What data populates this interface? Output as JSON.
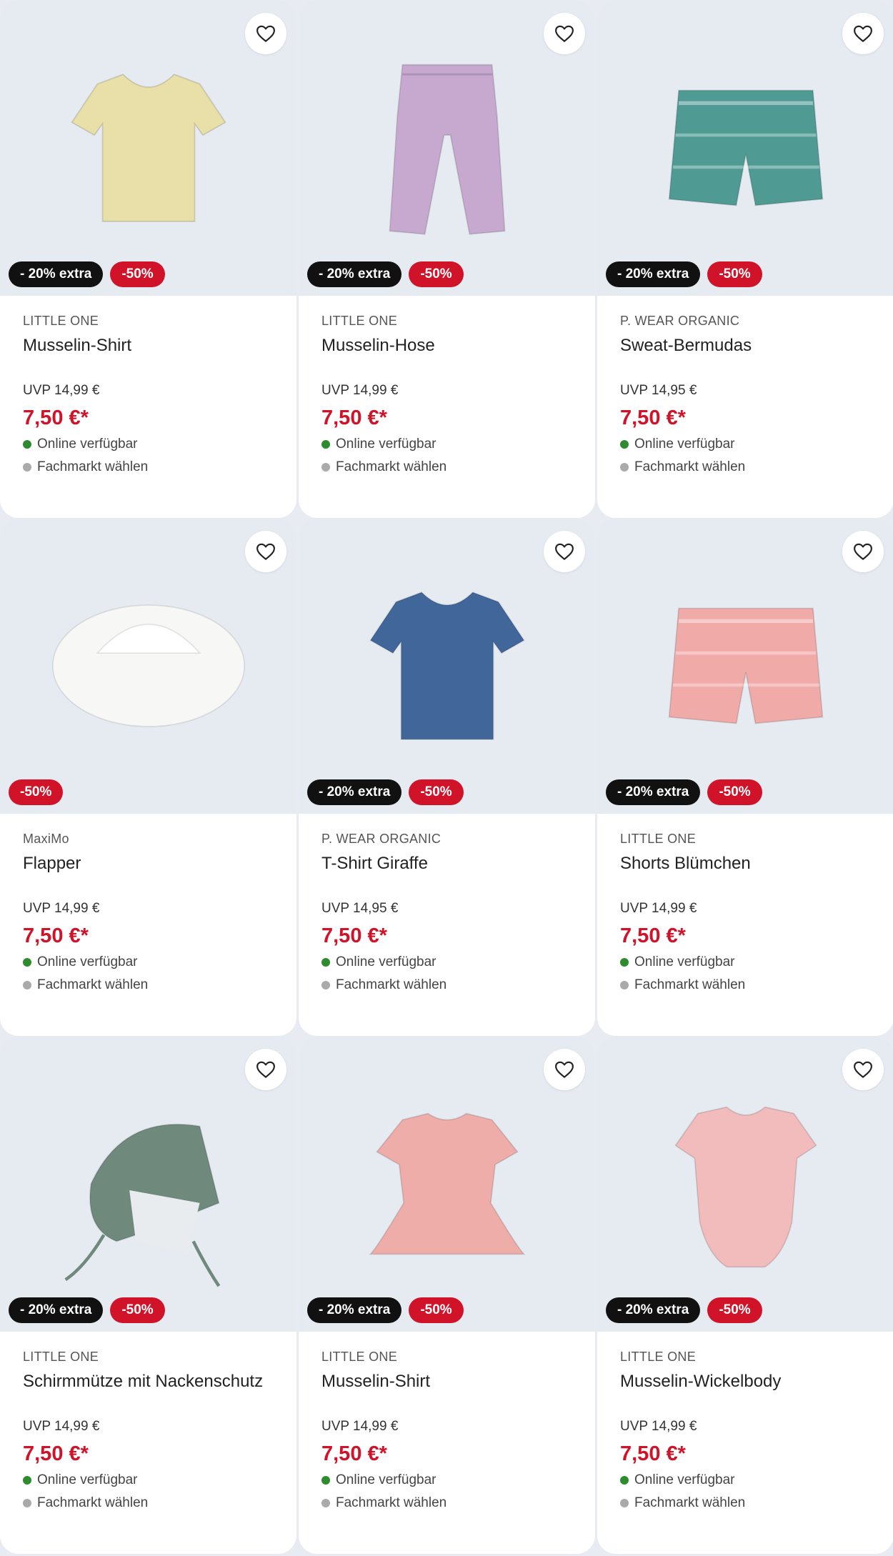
{
  "products": [
    {
      "brand": "LITTLE ONE",
      "title": "Musselin-Shirt",
      "uvp": "UVP 14,99 €",
      "price": "7,50 €*",
      "badge_extra": "- 20% extra",
      "badge_sale": "-50%",
      "online": "Online verfügbar",
      "store": "Fachmarkt wählen",
      "image_icon": "tshirt-icon",
      "color": "#e8e0a8"
    },
    {
      "brand": "LITTLE ONE",
      "title": "Musselin-Hose",
      "uvp": "UVP 14,99 €",
      "price": "7,50 €*",
      "badge_extra": "- 20% extra",
      "badge_sale": "-50%",
      "online": "Online verfügbar",
      "store": "Fachmarkt wählen",
      "image_icon": "pants-icon",
      "color": "#c7a9cf"
    },
    {
      "brand": "P. WEAR ORGANIC",
      "title": "Sweat-Bermudas",
      "uvp": "UVP 14,95 €",
      "price": "7,50 €*",
      "badge_extra": "- 20% extra",
      "badge_sale": "-50%",
      "online": "Online verfügbar",
      "store": "Fachmarkt wählen",
      "image_icon": "shorts-icon",
      "color": "#4f9a93"
    },
    {
      "brand": "MaxiMo",
      "title": "Flapper",
      "uvp": "UVP 14,99 €",
      "price": "7,50 €*",
      "badge_extra": "",
      "badge_sale": "-50%",
      "online": "Online verfügbar",
      "store": "Fachmarkt wählen",
      "image_icon": "sunhat-icon",
      "color": "#f7f7f5"
    },
    {
      "brand": "P. WEAR ORGANIC",
      "title": "T-Shirt Giraffe",
      "uvp": "UVP 14,95 €",
      "price": "7,50 €*",
      "badge_extra": "- 20% extra",
      "badge_sale": "-50%",
      "online": "Online verfügbar",
      "store": "Fachmarkt wählen",
      "image_icon": "tshirt-icon",
      "color": "#41679a"
    },
    {
      "brand": "LITTLE ONE",
      "title": "Shorts Blümchen",
      "uvp": "UVP 14,99 €",
      "price": "7,50 €*",
      "badge_extra": "- 20% extra",
      "badge_sale": "-50%",
      "online": "Online verfügbar",
      "store": "Fachmarkt wählen",
      "image_icon": "shorts-icon",
      "color": "#f0aaa8"
    },
    {
      "brand": "LITTLE ONE",
      "title": "Schirmmütze mit Nackenschutz",
      "uvp": "UVP 14,99 €",
      "price": "7,50 €*",
      "badge_extra": "- 20% extra",
      "badge_sale": "-50%",
      "online": "Online verfügbar",
      "store": "Fachmarkt wählen",
      "image_icon": "cap-icon",
      "color": "#6f8a7c"
    },
    {
      "brand": "LITTLE ONE",
      "title": "Musselin-Shirt",
      "uvp": "UVP 14,99 €",
      "price": "7,50 €*",
      "badge_extra": "- 20% extra",
      "badge_sale": "-50%",
      "online": "Online verfügbar",
      "store": "Fachmarkt wählen",
      "image_icon": "blouse-icon",
      "color": "#efadaa"
    },
    {
      "brand": "LITTLE ONE",
      "title": "Musselin-Wickelbody",
      "uvp": "UVP 14,99 €",
      "price": "7,50 €*",
      "badge_extra": "- 20% extra",
      "badge_sale": "-50%",
      "online": "Online verfügbar",
      "store": "Fachmarkt wählen",
      "image_icon": "bodysuit-icon",
      "color": "#f3bcbc"
    }
  ],
  "favorite_icon": "heart-outline-icon",
  "colors": {
    "sale_red": "#d1132a",
    "extra_black": "#111111",
    "available_green": "#2e8b2e",
    "image_bg": "#e6eaf1"
  }
}
